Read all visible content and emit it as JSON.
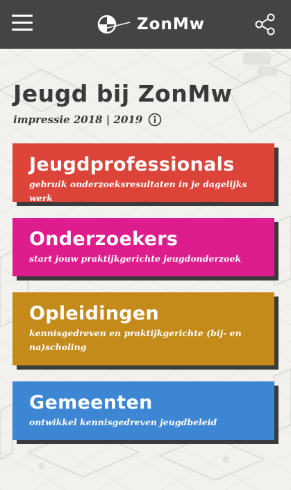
{
  "header": {
    "menu_icon": "hamburger-menu-icon",
    "logo_text": "ZonMw",
    "share_icon": "share-icon"
  },
  "page": {
    "title": "Jeugd bij ZonMw",
    "subtitle": "impressie 2018 | 2019",
    "info_icon": "info-icon"
  },
  "cards": [
    {
      "title": "Jeugdprofessionals",
      "subtitle": "gebruik onderzoeksresultaten in je dagelijks werk",
      "color": "#dc4339"
    },
    {
      "title": "Onderzoekers",
      "subtitle": "start jouw praktijkgerichte jeugdonderzoek",
      "color": "#dd1c8d"
    },
    {
      "title": "Opleidingen",
      "subtitle": "kennisgedreven en praktijkgerichte (bij- en na)scholing",
      "color": "#c48b1b"
    },
    {
      "title": "Gemeenten",
      "subtitle": "ontwikkel kennisgedreven jeugdbeleid",
      "color": "#3c86d3"
    }
  ],
  "colors": {
    "header_bg": "#464442",
    "page_bg": "#f1f0ec",
    "shadow": "#3b3b3b"
  }
}
